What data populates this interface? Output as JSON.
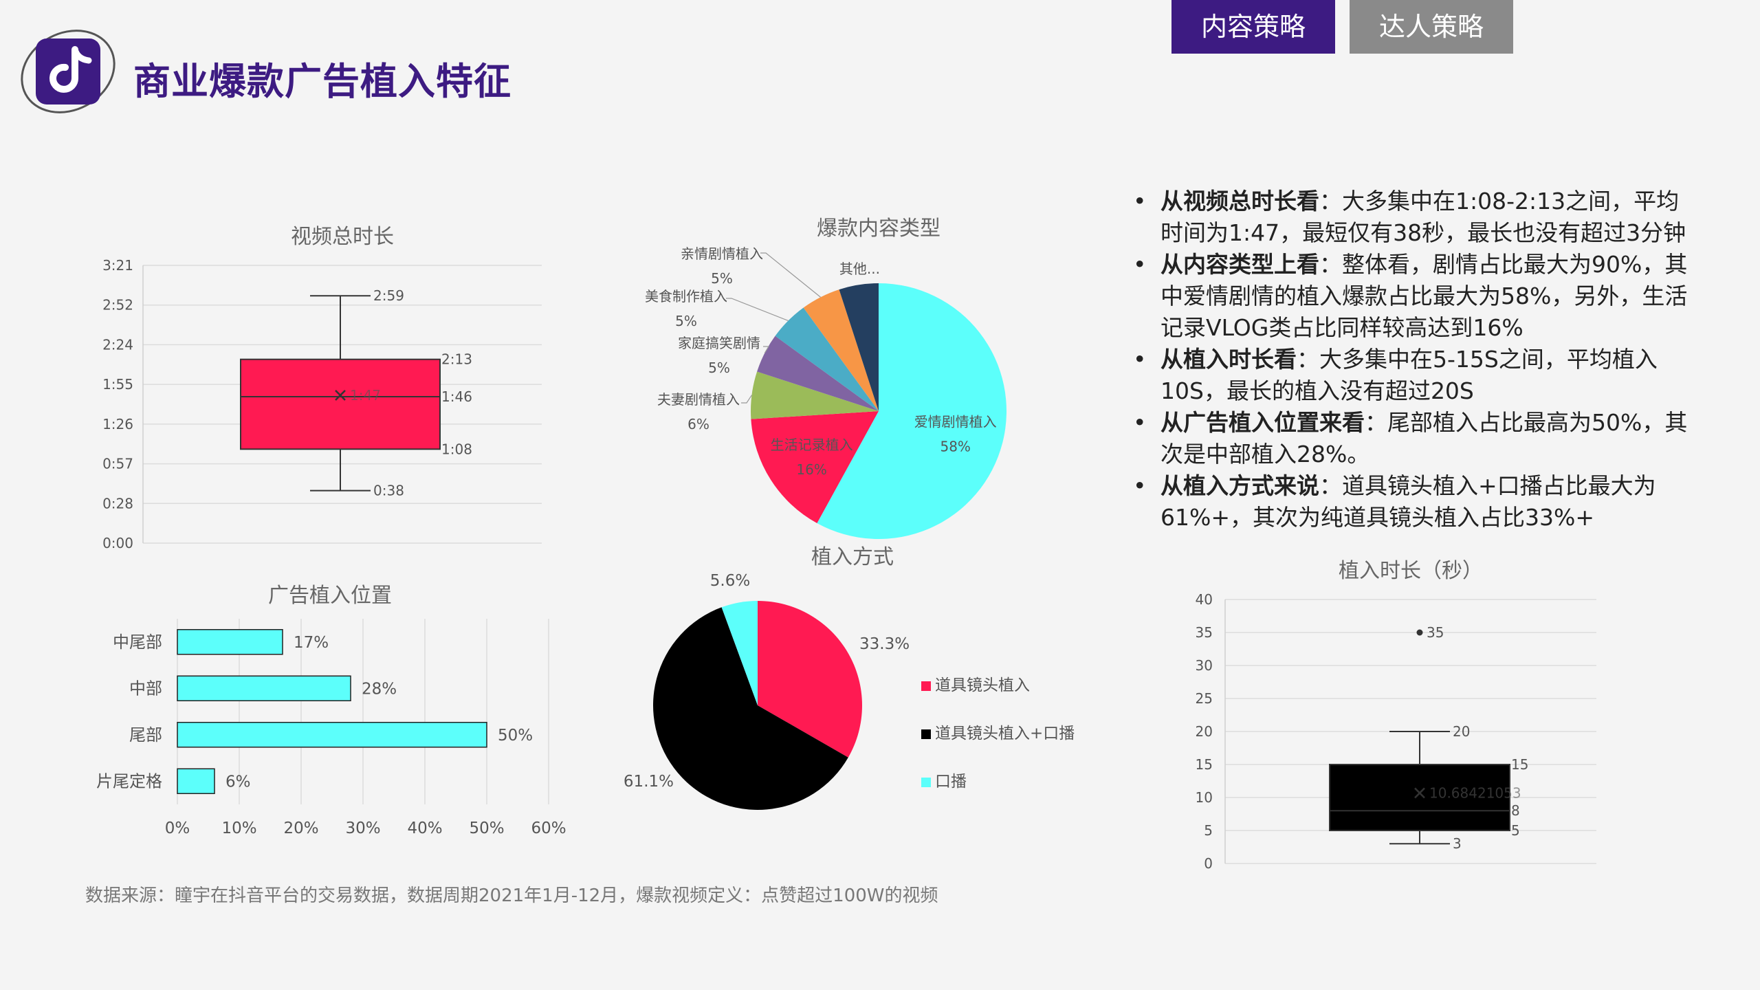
{
  "header": {
    "title": "商业爆款广告植入特征",
    "tabs": [
      {
        "label": "内容策略",
        "active": true
      },
      {
        "label": "达人策略",
        "active": false
      }
    ]
  },
  "colors": {
    "accent": "#3d1b82",
    "cyan": "#5cfffb",
    "red": "#ff1a52",
    "black": "#000000"
  },
  "chart_data": [
    {
      "id": "video-duration",
      "type": "box",
      "title": "视频总时长",
      "y_ticks": [
        "0:00",
        "0:28",
        "0:57",
        "1:26",
        "1:55",
        "2:24",
        "2:52",
        "3:21"
      ],
      "ylim": [
        0,
        201
      ],
      "box": {
        "min": 38,
        "q1": 68,
        "median": 106,
        "q3": 133,
        "max": 179,
        "mean": 107
      },
      "labels": {
        "min": "0:38",
        "q1": "1:08",
        "median": "1:46",
        "q3": "2:13",
        "max": "2:59",
        "mean": "1:47"
      },
      "color": "#ff1a52"
    },
    {
      "id": "content-type",
      "type": "pie",
      "title": "爆款内容类型",
      "slices": [
        {
          "name": "爱情剧情植入",
          "value": 58,
          "label": "58%",
          "color": "#5cfffb"
        },
        {
          "name": "生活记录植入",
          "value": 16,
          "label": "16%",
          "color": "#ff1a52"
        },
        {
          "name": "夫妻剧情植入",
          "value": 6,
          "label": "6%",
          "color": "#9bbb59"
        },
        {
          "name": "家庭搞笑剧情",
          "value": 5,
          "label": "5%",
          "color": "#8064a2"
        },
        {
          "name": "美食制作植入",
          "value": 5,
          "label": "5%",
          "color": "#4bacc6"
        },
        {
          "name": "亲情剧情植入",
          "value": 5,
          "label": "5%",
          "color": "#f79646"
        },
        {
          "name": "其他...",
          "value": 5,
          "label": "",
          "color": "#243f60"
        }
      ]
    },
    {
      "id": "ad-position",
      "type": "bar",
      "title": "广告植入位置",
      "categories": [
        "中尾部",
        "中部",
        "尾部",
        "片尾定格"
      ],
      "values": [
        17,
        28,
        50,
        6
      ],
      "labels": [
        "17%",
        "28%",
        "50%",
        "6%"
      ],
      "x_ticks": [
        "0%",
        "10%",
        "20%",
        "30%",
        "40%",
        "50%",
        "60%"
      ],
      "xlim": [
        0,
        60
      ],
      "color": "#5cfffb"
    },
    {
      "id": "placement-method",
      "type": "pie",
      "title": "植入方式",
      "slices": [
        {
          "name": "道具镜头植入",
          "value": 33.3,
          "label": "33.3%",
          "color": "#ff1a52"
        },
        {
          "name": "道具镜头植入+口播",
          "value": 61.1,
          "label": "61.1%",
          "color": "#000000"
        },
        {
          "name": "口播",
          "value": 5.6,
          "label": "5.6%",
          "color": "#5cfffb"
        }
      ],
      "legend": [
        "道具镜头植入",
        "道具镜头植入+口播",
        "口播"
      ]
    },
    {
      "id": "placement-duration",
      "type": "box",
      "title": "植入时长（秒）",
      "y_ticks": [
        "0",
        "5",
        "10",
        "15",
        "20",
        "25",
        "30",
        "35",
        "40"
      ],
      "ylim": [
        0,
        40
      ],
      "box": {
        "min": 3,
        "q1": 5,
        "median": 8,
        "q3": 15,
        "max": 20,
        "mean": 10.68421053,
        "outlier": 35
      },
      "labels": {
        "min": "3",
        "q1": "5",
        "median": "8",
        "q3": "15",
        "max": "20",
        "mean": "10.68421053",
        "outlier": "35"
      },
      "color": "#000000"
    }
  ],
  "bullets": [
    {
      "head": "从视频总时长看",
      "body": "：大多集中在1:08-2:13之间，平均时间为1:47，最短仅有38秒，最长也没有超过3分钟"
    },
    {
      "head": "从内容类型上看",
      "body": "：整体看，剧情占比最大为90%，其中爱情剧情的植入爆款占比最大为58%，另外，生活记录VLOG类占比同样较高达到16%"
    },
    {
      "head": "从植入时长看",
      "body": "：大多集中在5-15S之间，平均植入10S，最长的植入没有超过20S"
    },
    {
      "head": "从广告植入位置来看",
      "body": "：尾部植入占比最高为50%，其次是中部植入28%。"
    },
    {
      "head": "从植入方式来说",
      "body": "：道具镜头植入+口播占比最大为61%+，其次为纯道具镜头植入占比33%+"
    }
  ],
  "footer": {
    "source": "数据来源：瞳宇在抖音平台的交易数据，数据周期2021年1月-12月，爆款视频定义：点赞超过100W的视频"
  }
}
